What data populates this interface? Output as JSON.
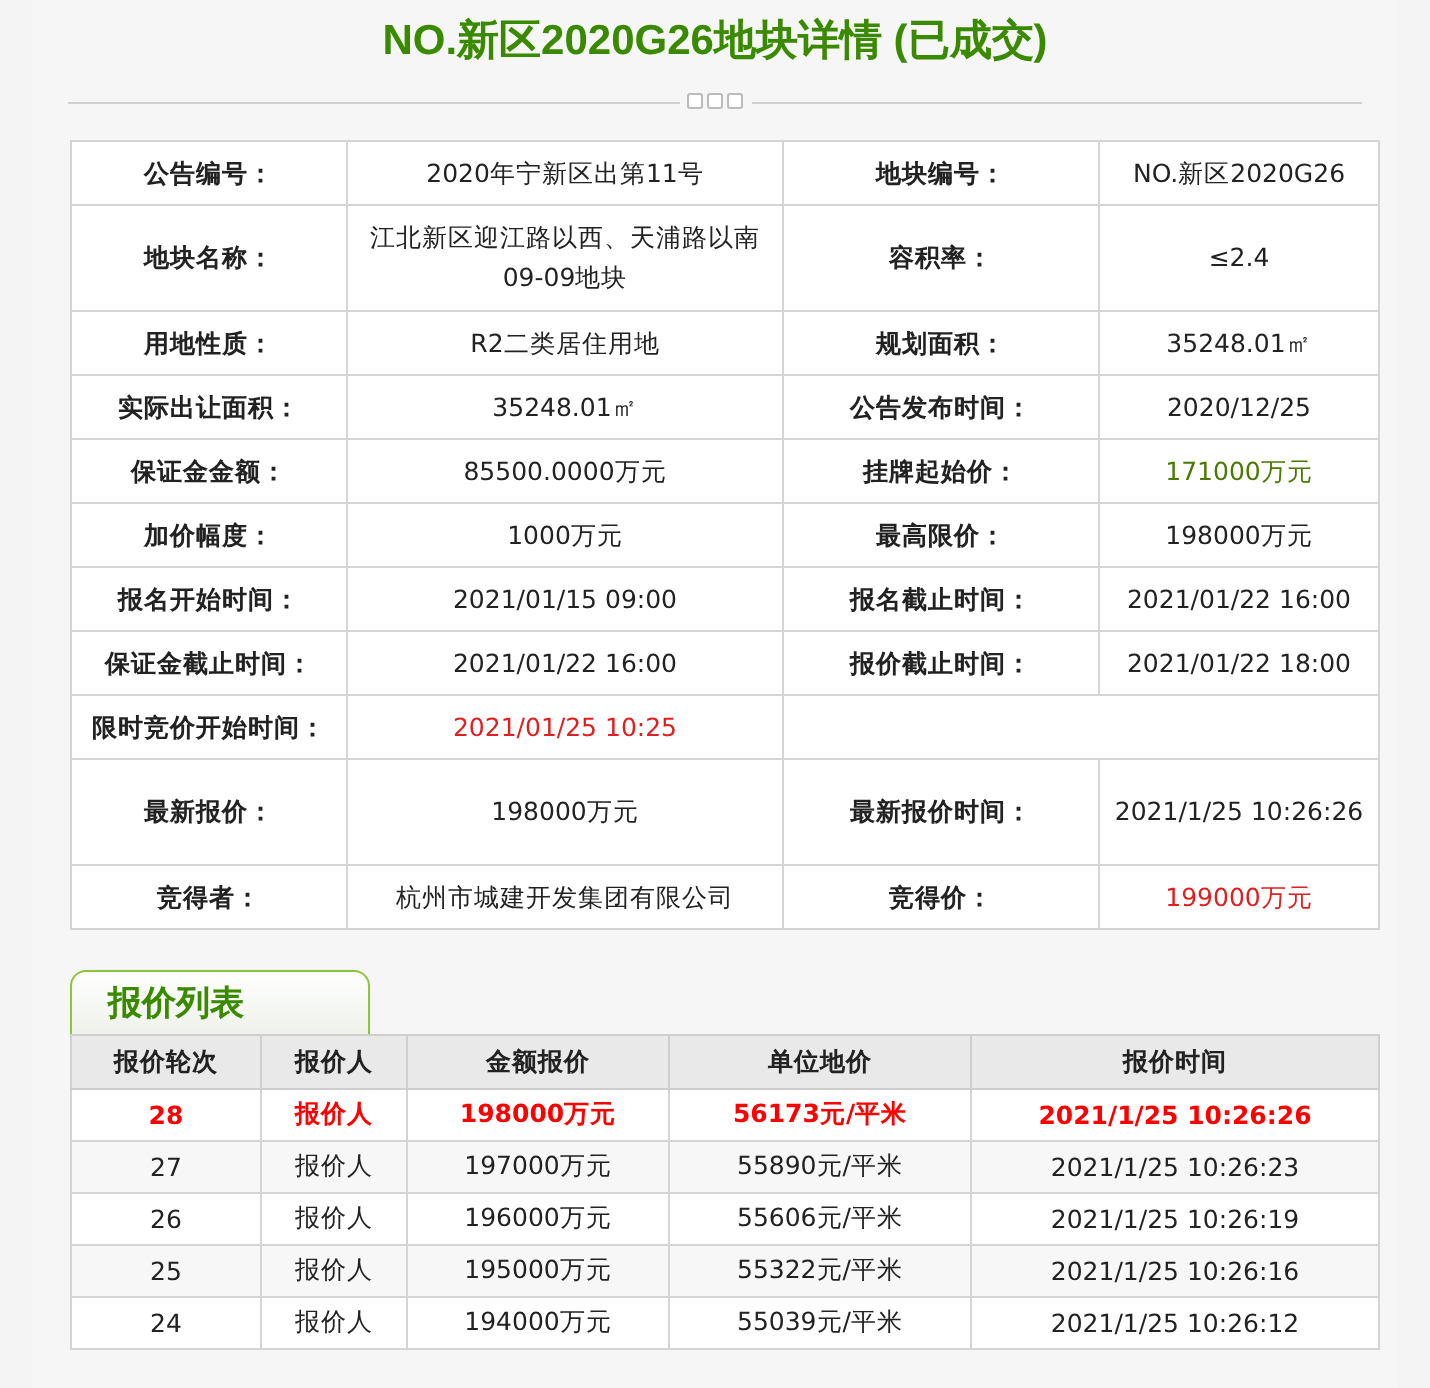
{
  "title": "NO.新区2020G26地块详情 (已成交)",
  "details": [
    [
      {
        "text": "公告编号："
      },
      {
        "text": "2020年宁新区出第11号"
      },
      {
        "text": "地块编号："
      },
      {
        "text": "NO.新区2020G26"
      }
    ],
    [
      {
        "text": "地块名称："
      },
      {
        "text": "江北新区迎江路以西、天浦路以南09-09地块"
      },
      {
        "text": "容积率："
      },
      {
        "text": "≤2.4"
      }
    ],
    [
      {
        "text": "用地性质："
      },
      {
        "text": "R2二类居住用地"
      },
      {
        "text": "规划面积："
      },
      {
        "text": "35248.01㎡"
      }
    ],
    [
      {
        "text": "实际出让面积："
      },
      {
        "text": "35248.01㎡"
      },
      {
        "text": "公告发布时间："
      },
      {
        "text": "2020/12/25"
      }
    ],
    [
      {
        "text": "保证金金额："
      },
      {
        "text": "85500.0000万元"
      },
      {
        "text": "挂牌起始价："
      },
      {
        "text": "171000万元",
        "color": "#4a7a00"
      }
    ],
    [
      {
        "text": "加价幅度："
      },
      {
        "text": "1000万元"
      },
      {
        "text": "最高限价："
      },
      {
        "text": "198000万元"
      }
    ],
    [
      {
        "text": "报名开始时间："
      },
      {
        "text": "2021/01/15 09:00"
      },
      {
        "text": "报名截止时间："
      },
      {
        "text": "2021/01/22 16:00"
      }
    ],
    [
      {
        "text": "保证金截止时间："
      },
      {
        "text": "2021/01/22 16:00"
      },
      {
        "text": "报价截止时间："
      },
      {
        "text": "2021/01/22 18:00"
      }
    ],
    [
      {
        "text": "限时竞价开始时间："
      },
      {
        "text": "2021/01/25 10:25",
        "color": "#e02020"
      }
    ],
    [
      {
        "text": "最新报价："
      },
      {
        "text": "198000万元"
      },
      {
        "text": "最新报价时间："
      },
      {
        "text": "2021/1/25 10:26:26"
      }
    ],
    [
      {
        "text": "竞得者："
      },
      {
        "text": "杭州市城建开发集团有限公司"
      },
      {
        "text": "竞得价："
      },
      {
        "text": "199000万元",
        "color": "#e02020"
      }
    ]
  ],
  "bids_tab": {
    "label": "报价列表",
    "selected": true
  },
  "bids": {
    "columns": [
      "报价轮次",
      "报价人",
      "金额报价",
      "单位地价",
      "报价时间"
    ],
    "rows": [
      {
        "cells": [
          "28",
          "报价人",
          "198000万元",
          "56173元/平米",
          "2021/1/25 10:26:26"
        ],
        "latest": true
      },
      {
        "cells": [
          "27",
          "报价人",
          "197000万元",
          "55890元/平米",
          "2021/1/25 10:26:23"
        ],
        "latest": false
      },
      {
        "cells": [
          "26",
          "报价人",
          "196000万元",
          "55606元/平米",
          "2021/1/25 10:26:19"
        ],
        "latest": false
      },
      {
        "cells": [
          "25",
          "报价人",
          "195000万元",
          "55322元/平米",
          "2021/1/25 10:26:16"
        ],
        "latest": false
      },
      {
        "cells": [
          "24",
          "报价人",
          "194000万元",
          "55039元/平米",
          "2021/1/25 10:26:12"
        ],
        "latest": false
      }
    ]
  }
}
